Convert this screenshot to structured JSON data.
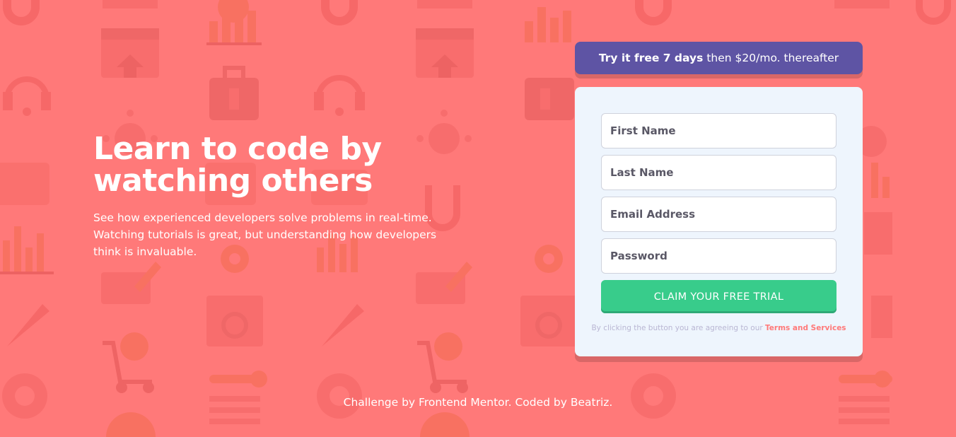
{
  "hero": {
    "title": "Learn to code by watching others",
    "description": "See how experienced developers solve problems in real-time. Watching tutorials is great, but understanding how developers think is invaluable."
  },
  "promo": {
    "strong": "Try it free 7 days",
    "rest": "then $20/mo. thereafter"
  },
  "form": {
    "first_name_placeholder": "First Name",
    "last_name_placeholder": "Last Name",
    "email_placeholder": "Email Address",
    "password_placeholder": "Password",
    "submit_label": "CLAIM YOUR FREE TRIAL",
    "terms_prefix": "By clicking the button you are agreeing to our",
    "terms_link": "Terms and Services"
  },
  "footer": {
    "text": "Challenge by Frontend Mentor. Coded by Beatriz."
  },
  "colors": {
    "background": "#ff7979",
    "banner": "#5e54a4",
    "card": "#eef5fd",
    "button": "#38cc8b",
    "terms_link": "#ff7979"
  },
  "icons": [
    "magnet-icon",
    "bar-chart-icon",
    "browser-window-icon",
    "headset-icon",
    "toolbox-icon",
    "virus-icon",
    "thumbs-up-icon",
    "gear-icon",
    "pencil-icon",
    "rocket-icon",
    "magnifier-icon",
    "cart-icon",
    "key-icon",
    "globe-icon"
  ]
}
